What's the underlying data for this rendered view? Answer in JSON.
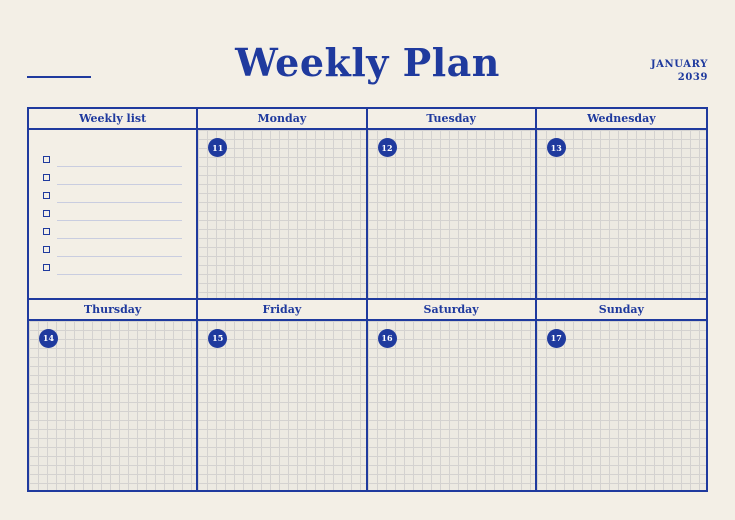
{
  "header": {
    "title": "Weekly Plan",
    "month": "JANUARY",
    "year": "2039"
  },
  "weekly_list": {
    "heading": "Weekly list",
    "item_count_visible": 7
  },
  "days": [
    {
      "name": "Monday",
      "date": "11"
    },
    {
      "name": "Tuesday",
      "date": "12"
    },
    {
      "name": "Wednesday",
      "date": "13"
    },
    {
      "name": "Thursday",
      "date": "14"
    },
    {
      "name": "Friday",
      "date": "15"
    },
    {
      "name": "Saturday",
      "date": "16"
    },
    {
      "name": "Sunday",
      "date": "17"
    }
  ],
  "colors": {
    "accent": "#1f3a9e",
    "background": "#f3efe6",
    "grid_fill": "#edeae2"
  }
}
